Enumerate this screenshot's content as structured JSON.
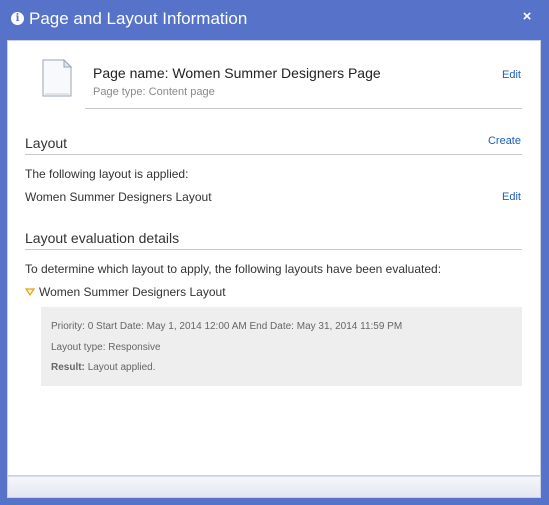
{
  "dialog": {
    "title": "Page and Layout Information",
    "close_symbol": "×",
    "info_symbol": "i",
    "colors": {
      "titlebar": "#5673c9",
      "link": "#1c5fb5",
      "details_bg": "#eeeeee",
      "toggle": "#e6a11c"
    }
  },
  "page": {
    "name_label": "Page name: Women Summer Designers Page",
    "type_label": "Page type: Content page",
    "edit_link": "Edit",
    "icon": "page-document-icon"
  },
  "layout": {
    "heading": "Layout",
    "create_link": "Create",
    "applied_intro": "The following layout is applied:",
    "applied_name": "Women Summer Designers Layout",
    "edit_link": "Edit"
  },
  "evaluation": {
    "heading": "Layout evaluation details",
    "intro": "To determine which layout to apply, the following layouts have been evaluated:",
    "item": {
      "name": "Women Summer Designers Layout",
      "toggle_icon": "triangle-down-icon",
      "priority_label": "Priority:",
      "priority_value": "0",
      "start_label": "Start Date:",
      "start_value": "May 1, 2014 12:00 AM",
      "end_label": "End Date:",
      "end_value": "May 31, 2014 11:59 PM",
      "type_line": "Layout type: Responsive",
      "result_label": "Result:",
      "result_value": "Layout applied."
    }
  }
}
